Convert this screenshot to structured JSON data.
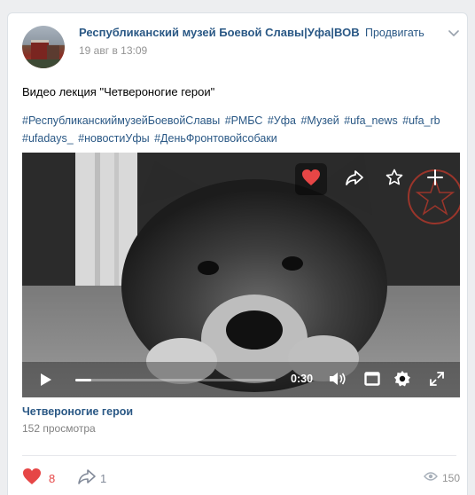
{
  "post": {
    "author": "Республиканский музей Боевой Славы|Уфа|ВОВ",
    "date": "19 авг в 13:09",
    "promote_label": "Продвигать",
    "text": "Видео лекция \"Четвероногие герои\"",
    "hashtags": [
      "#РеспубликанскиймузейБоевойСлавы",
      "#РМБС",
      "#Уфа",
      "#Музей",
      "#ufa_news",
      "#ufa_rb",
      "#ufadays_",
      "#новостиУфы",
      "#ДеньФронтовойсобаки"
    ]
  },
  "video": {
    "title": "Четвероногие герои",
    "views": "152 просмотра",
    "time": "0:30",
    "progress": 0.08,
    "overlay_buttons": [
      "heart-icon",
      "share-icon",
      "star-icon",
      "plus-icon"
    ],
    "controls": [
      "play-icon",
      "volume-icon",
      "miniplayer-icon",
      "settings-icon",
      "fullscreen-icon"
    ]
  },
  "footer": {
    "likes": "8",
    "shares": "1",
    "views": "150"
  },
  "colors": {
    "link": "#2a5885",
    "like_red": "#e64646",
    "muted": "#939393",
    "background": "#edeef0"
  }
}
